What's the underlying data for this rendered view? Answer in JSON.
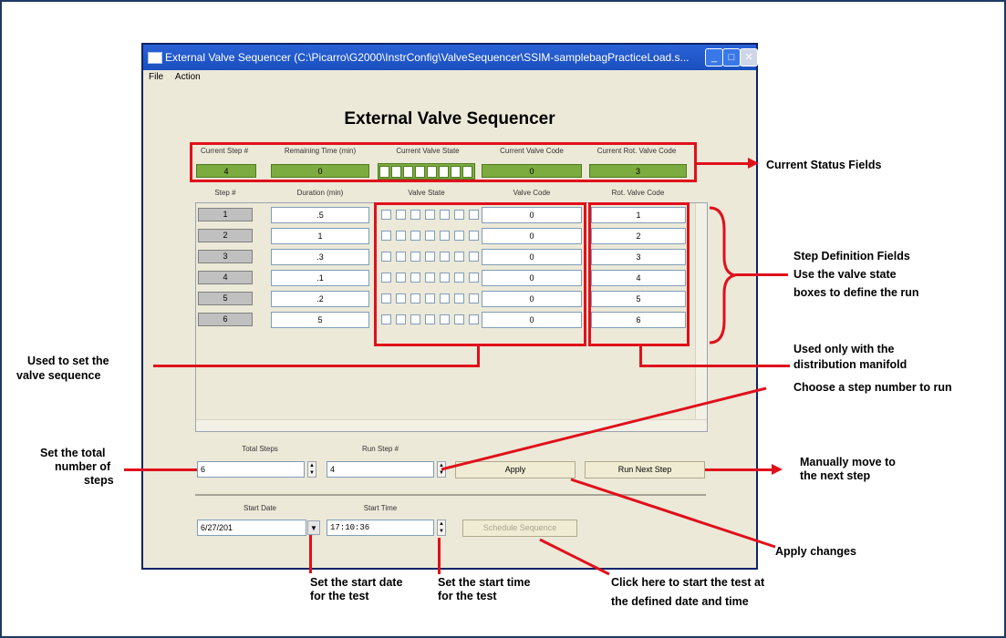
{
  "window": {
    "title": "External Valve Sequencer (C:\\Picarro\\G2000\\InstrConfig\\ValveSequencer\\SSIM-samplebagPracticeLoad.s...",
    "menu": [
      "File",
      "Action"
    ],
    "app_title": "External Valve Sequencer"
  },
  "status": {
    "labels": [
      "Current Step #",
      "Remaining Time (min)",
      "Current Valve State",
      "Current Valve Code",
      "Current Rot. Valve Code"
    ],
    "values": [
      "4",
      "0",
      "",
      "0",
      "3"
    ]
  },
  "table": {
    "headers": [
      "Step #",
      "Duration (min)",
      "Valve State",
      "Valve Code",
      "Rot. Valve Code"
    ],
    "rows": [
      {
        "step": "1",
        "duration": ".5",
        "valve_code": "0",
        "rot_code": "1"
      },
      {
        "step": "2",
        "duration": "1",
        "valve_code": "0",
        "rot_code": "2"
      },
      {
        "step": "3",
        "duration": ".3",
        "valve_code": "0",
        "rot_code": "3"
      },
      {
        "step": "4",
        "duration": ".1",
        "valve_code": "0",
        "rot_code": "4"
      },
      {
        "step": "5",
        "duration": ".2",
        "valve_code": "0",
        "rot_code": "5"
      },
      {
        "step": "6",
        "duration": "5",
        "valve_code": "0",
        "rot_code": "6"
      }
    ]
  },
  "controls": {
    "total_steps_label": "Total Steps",
    "total_steps_value": "6",
    "run_step_label": "Run Step #",
    "run_step_value": "4",
    "apply_label": "Apply",
    "run_next_label": "Run Next Step",
    "start_date_label": "Start Date",
    "start_date_value": "6/27/201",
    "start_time_label": "Start Time",
    "start_time_value": "17:10:36",
    "schedule_label": "Schedule Sequence"
  },
  "annotations": {
    "current_status": "Current Status Fields",
    "step_def_1": "Step Definition Fields",
    "step_def_2": "Use the valve state",
    "step_def_3": "boxes to define the run",
    "used_set_1": "Used to set the",
    "used_set_2": "valve sequence",
    "used_only_1": "Used only with the",
    "used_only_2": "distribution manifold",
    "choose_step": "Choose a step number to run",
    "set_total_1": "Set the total",
    "set_total_2": "number of",
    "set_total_3": "steps",
    "manual_1": "Manually move to",
    "manual_2": "the next step",
    "apply_changes": "Apply changes",
    "start_date_1": "Set the start date",
    "start_date_2": "for the test",
    "start_time_1": "Set the start time",
    "start_time_2": "for the test",
    "click_here_1": "Click here to start the test at",
    "click_here_2": "the defined date and time"
  },
  "colors": {
    "annotation_red": "#e0101b",
    "status_green": "#7cac3f",
    "titlebar_blue": "#1a4fbf"
  }
}
